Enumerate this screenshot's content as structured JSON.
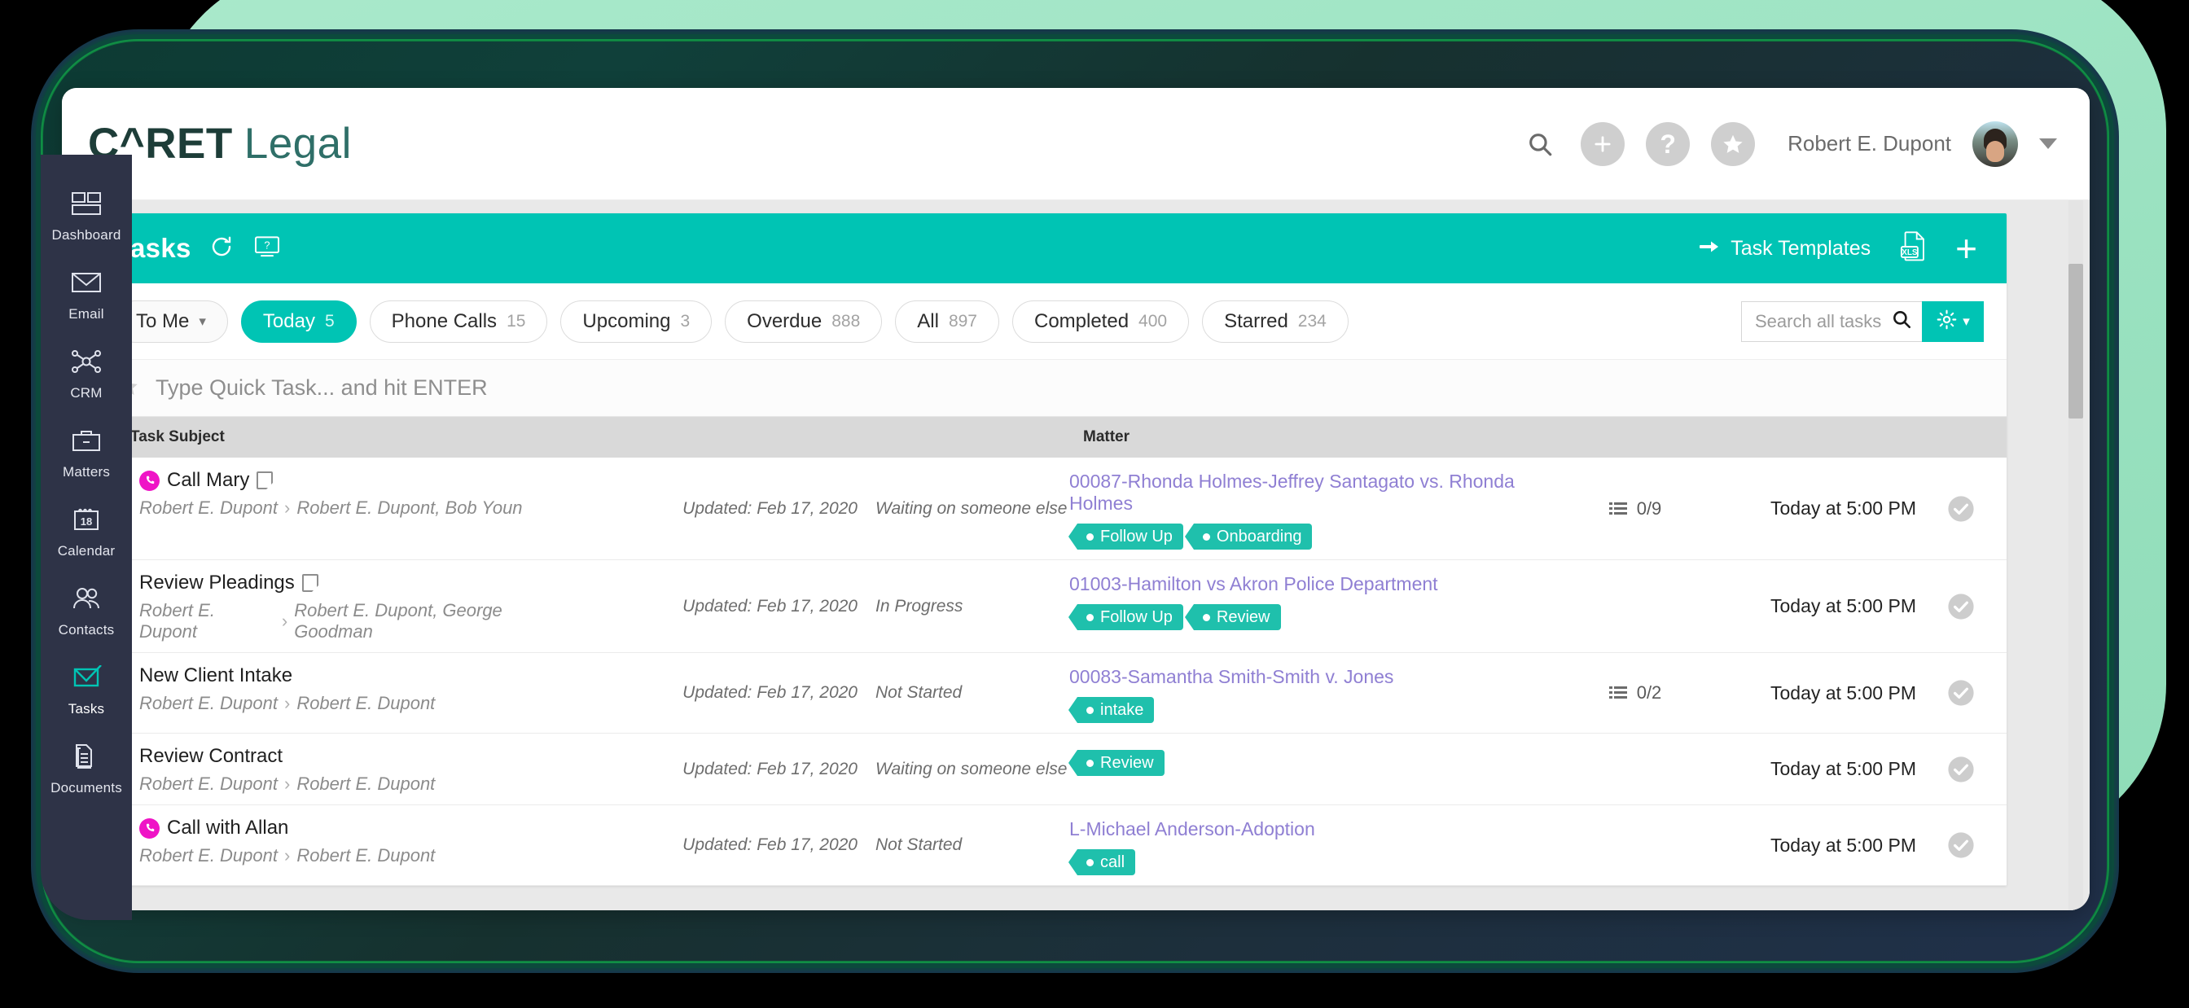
{
  "brand": {
    "name_bold": "C^RET",
    "name_light": "Legal"
  },
  "header": {
    "search_icon": "search-icon",
    "add_icon": "plus-icon",
    "help_icon": "question-icon",
    "star_icon": "star-icon",
    "user_name": "Robert E. Dupont",
    "avatar": "user-avatar",
    "caret": "chevron-down-icon"
  },
  "sidebar": {
    "items": [
      {
        "label": "Dashboard",
        "icon": "dashboard-icon",
        "active": false
      },
      {
        "label": "Email",
        "icon": "envelope-icon",
        "active": false
      },
      {
        "label": "CRM",
        "icon": "network-nodes-icon",
        "active": false
      },
      {
        "label": "Matters",
        "icon": "briefcase-icon",
        "active": false
      },
      {
        "label": "Calendar",
        "icon": "calendar-18-icon",
        "active": false
      },
      {
        "label": "Contacts",
        "icon": "people-icon",
        "active": false
      },
      {
        "label": "Tasks",
        "icon": "envelope-check-icon",
        "active": true
      },
      {
        "label": "Documents",
        "icon": "documents-icon",
        "active": false
      }
    ]
  },
  "toolbar": {
    "title": "Tasks",
    "refresh_icon": "refresh-icon",
    "help_icon": "monitor-help-icon",
    "templates_label": "Task Templates",
    "templates_arrow": "arrow-right-icon",
    "export_icon": "xls-export-icon",
    "add_label": "+"
  },
  "filters": {
    "assignee": {
      "label": "To Me",
      "chevron": "chevron-down-icon"
    },
    "pills": [
      {
        "label": "Today",
        "count": "5",
        "active": true
      },
      {
        "label": "Phone Calls",
        "count": "15",
        "active": false
      },
      {
        "label": "Upcoming",
        "count": "3",
        "active": false
      },
      {
        "label": "Overdue",
        "count": "888",
        "active": false
      },
      {
        "label": "All",
        "count": "897",
        "active": false
      },
      {
        "label": "Completed",
        "count": "400",
        "active": false
      },
      {
        "label": "Starred",
        "count": "234",
        "active": false
      }
    ],
    "search_placeholder": "Search all tasks",
    "search_value": "",
    "search_icon": "search-icon",
    "settings_icon": "gear-icon",
    "settings_chevron": "chevron-down-icon"
  },
  "quick_task": {
    "star_icon": "star-icon",
    "placeholder": "Type Quick Task... and hit ENTER"
  },
  "table": {
    "columns": {
      "subject": "Task Subject",
      "matter": "Matter"
    },
    "rows": [
      {
        "bar_color": "#1aa64b",
        "starred": true,
        "has_phone": true,
        "has_note": true,
        "subject": "Call Mary",
        "owner": "Robert E. Dupont",
        "assignees": "Robert E. Dupont, Bob Youn",
        "updated": "Updated: Feb 17, 2020",
        "status": "Waiting on someone else",
        "matter": "00087-Rhonda Holmes-Jeffrey Santagato vs. Rhonda Holmes",
        "tags": [
          "Follow Up",
          "Onboarding"
        ],
        "checklist": "0/9",
        "due": "Today at 5:00 PM"
      },
      {
        "bar_color": "#e5179f",
        "starred": true,
        "has_phone": false,
        "has_note": true,
        "subject": "Review Pleadings",
        "owner": "Robert E. Dupont",
        "assignees": "Robert E. Dupont, George Goodman",
        "updated": "Updated: Feb 17, 2020",
        "status": "In Progress",
        "matter": "01003-Hamilton vs Akron Police Department",
        "tags": [
          "Follow Up",
          "Review"
        ],
        "checklist": "",
        "due": "Today at 5:00 PM"
      },
      {
        "bar_color": "#2b2b2b",
        "starred": true,
        "has_phone": false,
        "has_note": false,
        "subject": "New Client Intake",
        "owner": "Robert E. Dupont",
        "assignees": "Robert E. Dupont",
        "updated": "Updated: Feb 17, 2020",
        "status": "Not Started",
        "matter": "00083-Samantha Smith-Smith v. Jones",
        "tags": [
          "intake"
        ],
        "checklist": "0/2",
        "due": "Today at 5:00 PM"
      },
      {
        "bar_color": "transparent",
        "starred": false,
        "has_phone": false,
        "has_note": false,
        "subject": "Review Contract",
        "owner": "Robert E. Dupont",
        "assignees": "Robert E. Dupont",
        "updated": "Updated: Feb 17, 2020",
        "status": "Waiting on someone else",
        "matter": "",
        "tags": [
          "Review"
        ],
        "checklist": "",
        "due": "Today at 5:00 PM"
      },
      {
        "bar_color": "#2f8fe5",
        "starred": false,
        "has_phone": true,
        "has_note": false,
        "subject": "Call with Allan",
        "owner": "Robert E. Dupont",
        "assignees": "Robert E. Dupont",
        "updated": "Updated: Feb 17, 2020",
        "status": "Not Started",
        "matter": "L-Michael Anderson-Adoption",
        "tags": [
          "call"
        ],
        "checklist": "",
        "due": "Today at 5:00 PM"
      }
    ]
  },
  "rail": {
    "collapse_icon": "chevron-left-icon"
  },
  "colors": {
    "accent": "#00c4b4",
    "tag": "#1fc0ac",
    "matter_link": "#8f7fd3",
    "star": "#f2c12e"
  }
}
